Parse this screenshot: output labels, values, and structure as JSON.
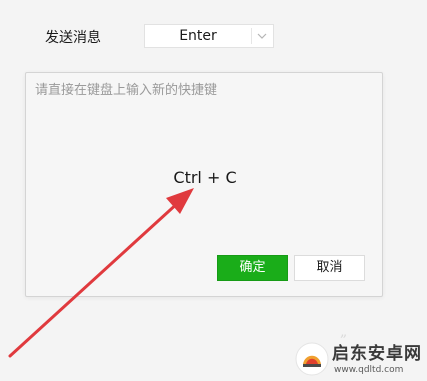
{
  "settings": {
    "send_message_label": "发送消息",
    "send_message_value": "Enter"
  },
  "shortcut_dialog": {
    "hint": "请直接在键盘上输入新的快捷键",
    "captured_shortcut": "Ctrl + C",
    "confirm_label": "确定",
    "cancel_label": "取消"
  },
  "watermark": {
    "name": "启东安卓网",
    "url": "www.qdltd.com"
  },
  "colors": {
    "confirm_button": "#1aad19",
    "annotation_arrow": "#e03a3e"
  },
  "icons": {
    "dropdown": "chevron-down-icon",
    "annotation": "arrow-icon"
  }
}
